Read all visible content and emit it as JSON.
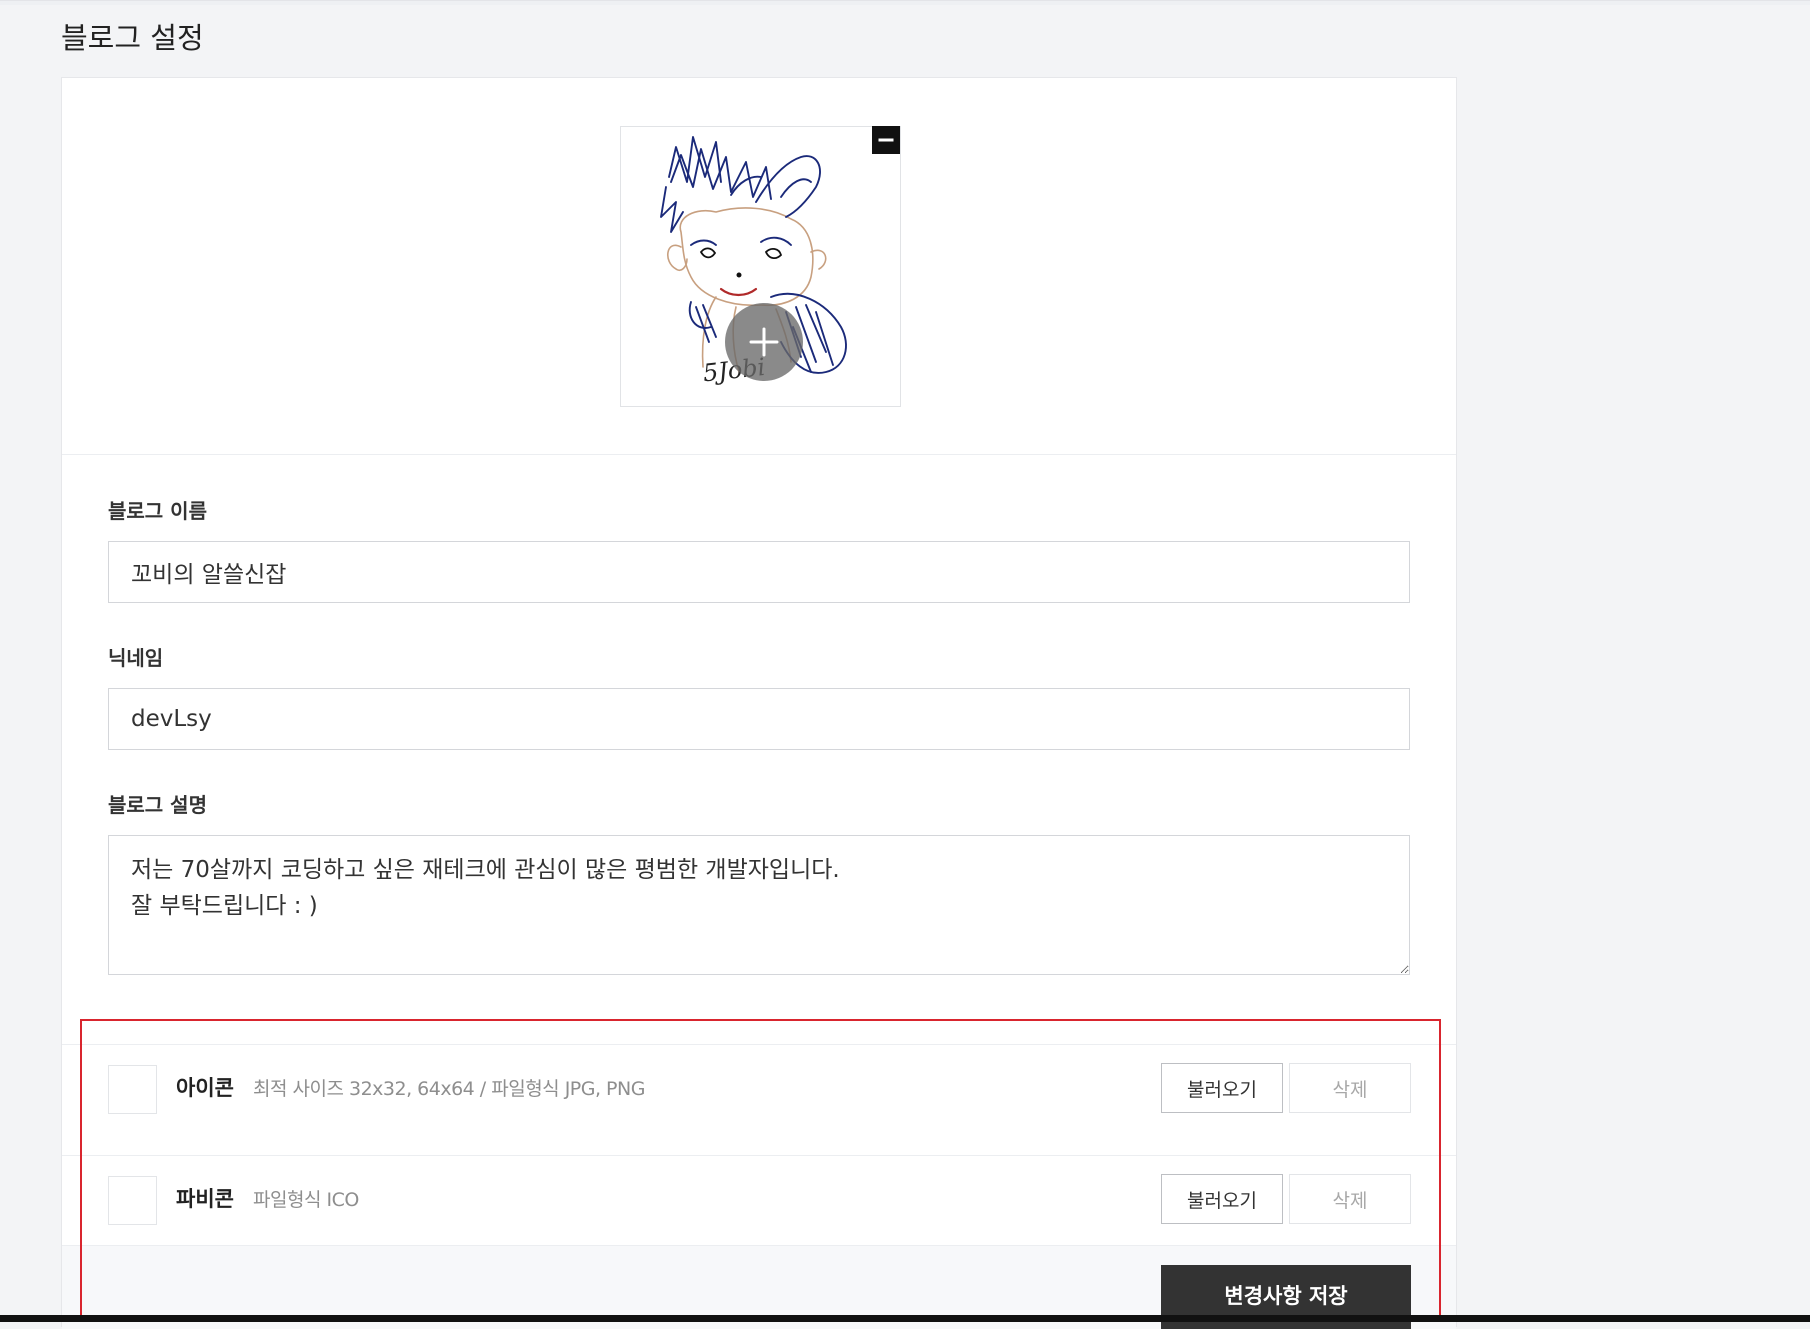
{
  "page": {
    "title": "블로그 설정"
  },
  "profile": {
    "image_signature": "5Jobi",
    "remove_icon": "minus-icon",
    "add_icon": "plus-icon"
  },
  "fields": {
    "blog_name": {
      "label": "블로그 이름",
      "value": "꼬비의 알쓸신잡"
    },
    "nickname": {
      "label": "닉네임",
      "value": "devLsy"
    },
    "description": {
      "label": "블로그 설명",
      "value": "저는 70살까지 코딩하고 싶은 재테크에 관심이 많은 평범한 개발자입니다.\n잘 부탁드립니다 : )"
    }
  },
  "icon_setting": {
    "title": "아이콘",
    "description": "최적 사이즈 32x32, 64x64 / 파일형식 JPG, PNG",
    "load_label": "불러오기",
    "delete_label": "삭제"
  },
  "favicon_setting": {
    "title": "파비콘",
    "description": "파일형식 ICO",
    "load_label": "불러오기",
    "delete_label": "삭제"
  },
  "actions": {
    "save_label": "변경사항 저장"
  },
  "colors": {
    "highlight": "#d9252e",
    "save_button": "#333333",
    "drawing_ink": "#1b2a7a",
    "drawing_skin": "#c8a080"
  }
}
